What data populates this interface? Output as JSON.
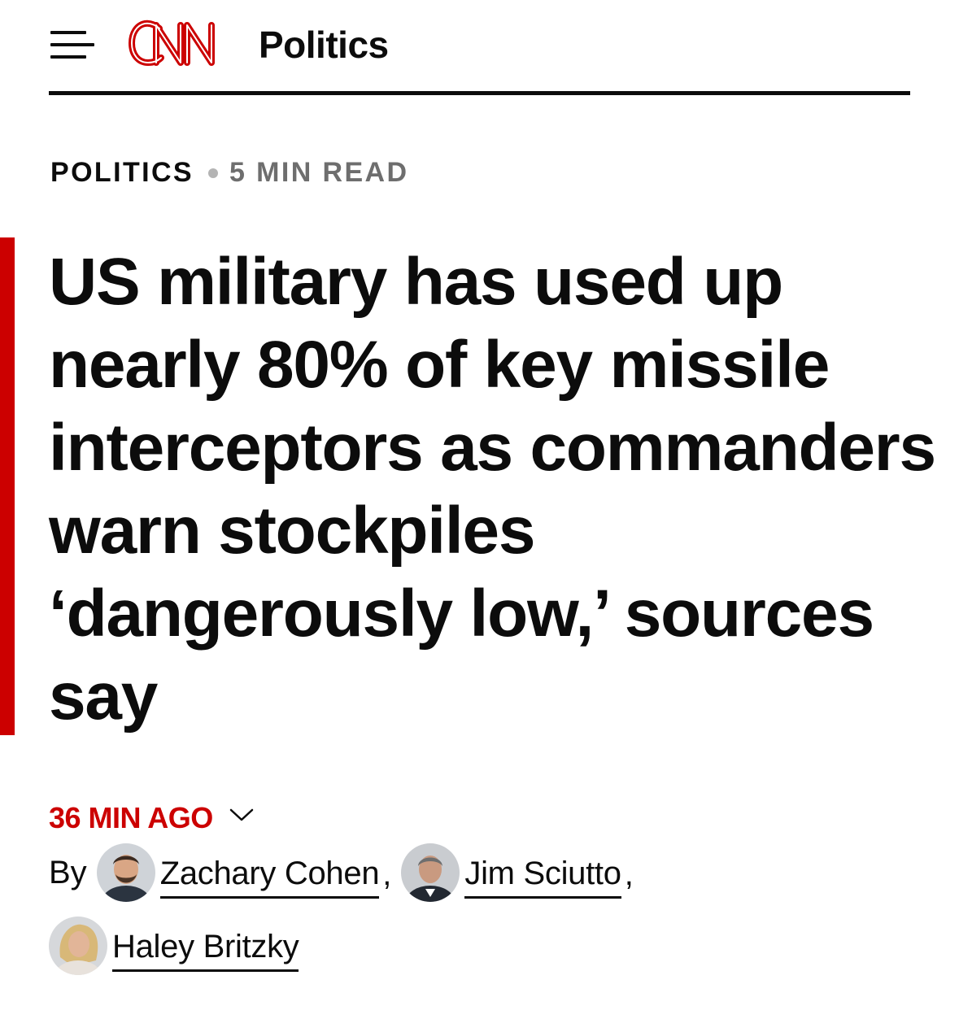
{
  "header": {
    "menu_icon": "hamburger-menu-icon",
    "logo_text": "CNN",
    "section_title": "Politics",
    "brand_color": "#cc0000"
  },
  "meta": {
    "kicker": "POLITICS",
    "read_time": "5 MIN READ"
  },
  "headline": "US military has used up nearly 80% of key missile interceptors as commanders warn stockpiles ‘dangerously low,’ sources say",
  "timestamp": {
    "label": "36 MIN AGO",
    "chevron_icon": "chevron-down-icon"
  },
  "byline": {
    "prefix": "By",
    "authors": [
      {
        "name": "Zachary Cohen",
        "separator": ","
      },
      {
        "name": "Jim Sciutto",
        "separator": ","
      },
      {
        "name": "Haley Britzky",
        "separator": ""
      }
    ]
  }
}
